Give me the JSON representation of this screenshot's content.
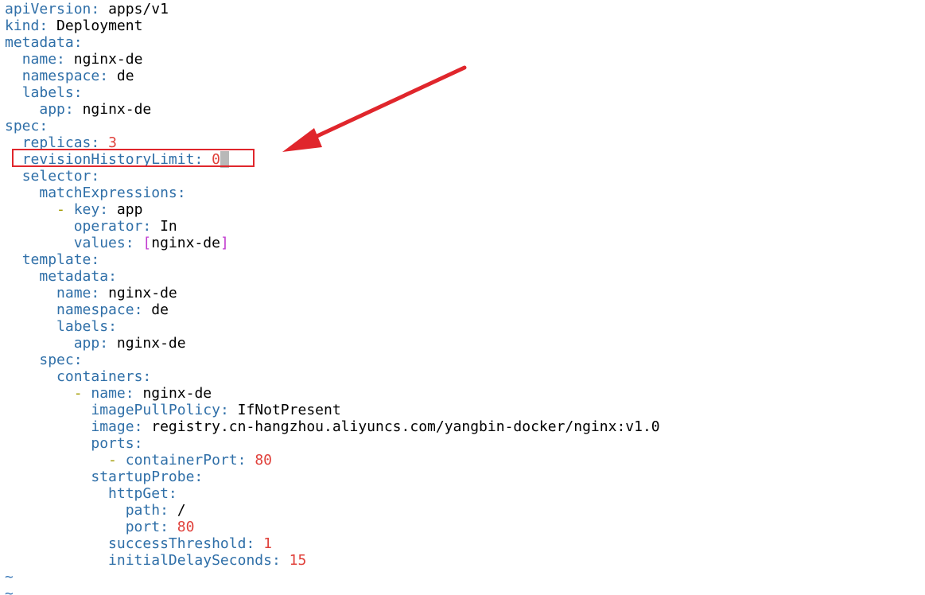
{
  "editor": {
    "lines": [
      {
        "indent": "",
        "dash": "",
        "key": "apiVersion",
        "value": "apps/v1",
        "value_type": "text"
      },
      {
        "indent": "",
        "dash": "",
        "key": "kind",
        "value": "Deployment",
        "value_type": "text"
      },
      {
        "indent": "",
        "dash": "",
        "key": "metadata",
        "value": "",
        "value_type": "text"
      },
      {
        "indent": "  ",
        "dash": "",
        "key": "name",
        "value": "nginx-de",
        "value_type": "text"
      },
      {
        "indent": "  ",
        "dash": "",
        "key": "namespace",
        "value": "de",
        "value_type": "text"
      },
      {
        "indent": "  ",
        "dash": "",
        "key": "labels",
        "value": "",
        "value_type": "text"
      },
      {
        "indent": "    ",
        "dash": "",
        "key": "app",
        "value": "nginx-de",
        "value_type": "text"
      },
      {
        "indent": "",
        "dash": "",
        "key": "spec",
        "value": "",
        "value_type": "text"
      },
      {
        "indent": "  ",
        "dash": "",
        "key": "replicas",
        "value": "3",
        "value_type": "number"
      },
      {
        "indent": "  ",
        "dash": "",
        "key": "revisionHistoryLimit",
        "value": "0",
        "value_type": "number",
        "cursor": true
      },
      {
        "indent": "  ",
        "dash": "",
        "key": "selector",
        "value": "",
        "value_type": "text"
      },
      {
        "indent": "    ",
        "dash": "",
        "key": "matchExpressions",
        "value": "",
        "value_type": "text"
      },
      {
        "indent": "      ",
        "dash": "- ",
        "key": "key",
        "value": "app",
        "value_type": "text"
      },
      {
        "indent": "        ",
        "dash": "",
        "key": "operator",
        "value": "In",
        "value_type": "text"
      },
      {
        "indent": "        ",
        "dash": "",
        "key": "values",
        "value": "nginx-de",
        "value_type": "list"
      },
      {
        "indent": "  ",
        "dash": "",
        "key": "template",
        "value": "",
        "value_type": "text"
      },
      {
        "indent": "    ",
        "dash": "",
        "key": "metadata",
        "value": "",
        "value_type": "text"
      },
      {
        "indent": "      ",
        "dash": "",
        "key": "name",
        "value": "nginx-de",
        "value_type": "text"
      },
      {
        "indent": "      ",
        "dash": "",
        "key": "namespace",
        "value": "de",
        "value_type": "text"
      },
      {
        "indent": "      ",
        "dash": "",
        "key": "labels",
        "value": "",
        "value_type": "text"
      },
      {
        "indent": "        ",
        "dash": "",
        "key": "app",
        "value": "nginx-de",
        "value_type": "text"
      },
      {
        "indent": "    ",
        "dash": "",
        "key": "spec",
        "value": "",
        "value_type": "text"
      },
      {
        "indent": "      ",
        "dash": "",
        "key": "containers",
        "value": "",
        "value_type": "text"
      },
      {
        "indent": "        ",
        "dash": "- ",
        "key": "name",
        "value": "nginx-de",
        "value_type": "text"
      },
      {
        "indent": "          ",
        "dash": "",
        "key": "imagePullPolicy",
        "value": "IfNotPresent",
        "value_type": "text"
      },
      {
        "indent": "          ",
        "dash": "",
        "key": "image",
        "value": "registry.cn-hangzhou.aliyuncs.com/yangbin-docker/nginx:v1.0",
        "value_type": "text"
      },
      {
        "indent": "          ",
        "dash": "",
        "key": "ports",
        "value": "",
        "value_type": "text"
      },
      {
        "indent": "            ",
        "dash": "- ",
        "key": "containerPort",
        "value": "80",
        "value_type": "number"
      },
      {
        "indent": "          ",
        "dash": "",
        "key": "startupProbe",
        "value": "",
        "value_type": "text"
      },
      {
        "indent": "            ",
        "dash": "",
        "key": "httpGet",
        "value": "",
        "value_type": "text"
      },
      {
        "indent": "              ",
        "dash": "",
        "key": "path",
        "value": "/",
        "value_type": "text"
      },
      {
        "indent": "              ",
        "dash": "",
        "key": "port",
        "value": "80",
        "value_type": "number"
      },
      {
        "indent": "            ",
        "dash": "",
        "key": "successThreshold",
        "value": "1",
        "value_type": "number"
      },
      {
        "indent": "            ",
        "dash": "",
        "key": "initialDelaySeconds",
        "value": "15",
        "value_type": "number"
      }
    ],
    "tilde_lines": [
      "~",
      "~"
    ]
  },
  "annotation": {
    "highlight_color": "#e0262c",
    "arrow_color": "#e0262c"
  },
  "colors": {
    "key": "#2f6fa8",
    "number": "#e0413b",
    "dash": "#a39b00",
    "bracket": "#c23cd0",
    "tilde": "#3a79b8",
    "background": "#ffffff"
  }
}
